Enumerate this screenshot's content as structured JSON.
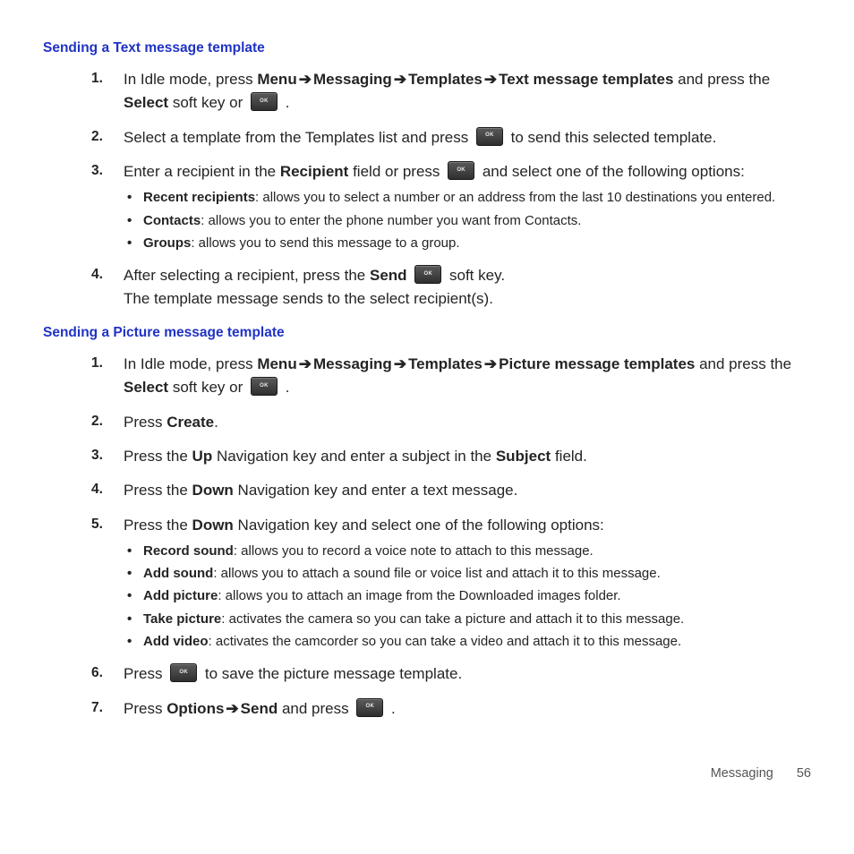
{
  "arrow": "➔",
  "headings": {
    "h1": "Sending a Text message template",
    "h2": "Sending a Picture message template"
  },
  "sec1": {
    "s1a": "In Idle mode, press ",
    "s1_menu": "Menu",
    "s1_mess": "Messaging",
    "s1_temp": "Templates",
    "s1_txt": "Text message templates",
    "s1b": " and press the ",
    "s1_select": "Select",
    "s1c": " soft key or ",
    "s1d": " .",
    "s2a": "Select a template from the Templates list and press ",
    "s2b": " to send this selected template.",
    "s3a": "Enter a recipient in the ",
    "s3_rec": "Recipient",
    "s3b": " field or press ",
    "s3c": " and select one of the following options:",
    "sub": {
      "a_b": "Recent recipients",
      "a_t": ": allows you to select a number or an address from the last 10 destinations you entered.",
      "b_b": "Contacts",
      "b_t": ": allows you to enter the phone number you want from Contacts.",
      "c_b": "Groups",
      "c_t": ": allows you to send this message to a group."
    },
    "s4a": "After selecting a recipient, press the ",
    "s4_send": "Send",
    "s4b": " soft key.",
    "s4c": "The template message sends to the select recipient(s)."
  },
  "sec2": {
    "s1a": "In Idle mode, press ",
    "s1_menu": "Menu",
    "s1_mess": "Messaging",
    "s1_temp": "Templates",
    "s1_pic": "Picture message templates",
    "s1b": " and press the ",
    "s1_select": "Select",
    "s1c": " soft key or ",
    "s1d": " .",
    "s2a": "Press ",
    "s2_create": "Create",
    "s2b": ".",
    "s3a": "Press the ",
    "s3_up": "Up",
    "s3b": " Navigation key and enter a subject in the ",
    "s3_subj": "Subject",
    "s3c": " field.",
    "s4a": "Press the ",
    "s4_down": "Down",
    "s4b": " Navigation key and enter a text message.",
    "s5a": "Press the ",
    "s5_down": "Down",
    "s5b": " Navigation key and select one of the following options:",
    "sub": {
      "a_b": "Record sound",
      "a_t": ": allows you to record a voice note to attach to this message.",
      "b_b": "Add sound",
      "b_t": ": allows you to attach a sound file or voice list and attach it to this message.",
      "c_b": "Add picture",
      "c_t": ": allows you to attach an image from the Downloaded images folder.",
      "d_b": "Take picture",
      "d_t": ": activates the camera so you can take a picture and attach it to this message.",
      "e_b": "Add video",
      "e_t": ": activates the camcorder so you can take a video and attach it to this message."
    },
    "s6a": "Press ",
    "s6b": " to save the picture message template.",
    "s7a": "Press ",
    "s7_opt": "Options",
    "s7_send": "Send",
    "s7b": " and press ",
    "s7c": " ."
  },
  "footer": {
    "section": "Messaging",
    "page": "56"
  }
}
